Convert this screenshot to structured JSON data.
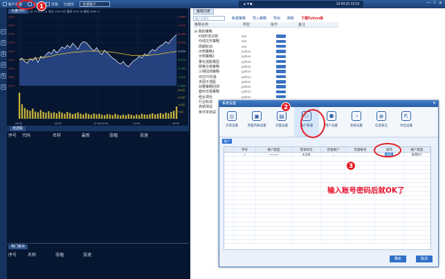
{
  "toolbar": {
    "items": [
      "账户设置",
      "委托",
      "交易",
      "已成交"
    ],
    "dropdown_value": "全部账户",
    "center_left": "▲▼◆",
    "center_time": "13:43:15 13:19",
    "window_controls": [
      "—",
      "□",
      "✕"
    ]
  },
  "rail": {
    "items": [
      "行",
      "资",
      "委",
      "成",
      "策",
      "设"
    ]
  },
  "chart": {
    "tab": "大盘分时",
    "info": "上证 3105.97 ▲ 成交 1230.5亿  最高 3120.48  最低 3085.17",
    "right_ticks": [
      "1.48%",
      "1.11%",
      "0.74%",
      "0.37%",
      "0.00%",
      "0.37%",
      "0.74%",
      "1.11%",
      "1.48%"
    ],
    "left_ticks": [
      "3150",
      "3140",
      "3130",
      "3120",
      "3110",
      "3100",
      "3090",
      "3080",
      "3070"
    ],
    "volume_ticks": [
      "280亿",
      "210亿",
      "140亿",
      "70亿"
    ],
    "time_ticks": [
      "09:30",
      "10:30",
      "11:30/13:00",
      "14:00",
      "15:00"
    ],
    "price_series": [
      3100,
      3102,
      3098,
      3096,
      3101,
      3099,
      3103,
      3097,
      3104,
      3102,
      3106,
      3109,
      3107,
      3112,
      3108,
      3111,
      3115,
      3113,
      3117,
      3114,
      3119,
      3116,
      3112,
      3118,
      3121,
      3120,
      3117,
      3113,
      3110,
      3114,
      3109,
      3106,
      3111,
      3108,
      3105,
      3102,
      3100,
      3097,
      3095,
      3098,
      3094,
      3092,
      3096,
      3099,
      3101,
      3104,
      3102,
      3107,
      3105,
      3109,
      3112,
      3110,
      3114,
      3116,
      3118,
      3121,
      3119,
      3123,
      3126,
      3129
    ],
    "avg_series": [
      3100,
      3100,
      3100,
      3100,
      3101,
      3101,
      3101,
      3102,
      3102,
      3103,
      3103,
      3104,
      3104,
      3105,
      3106,
      3106,
      3107,
      3107,
      3108,
      3108,
      3109,
      3109,
      3109,
      3109,
      3110,
      3110,
      3110,
      3110,
      3110,
      3110,
      3110,
      3110,
      3110,
      3109,
      3109,
      3109,
      3108,
      3108,
      3107,
      3107,
      3106,
      3106,
      3105,
      3105,
      3105,
      3105,
      3105,
      3105,
      3105,
      3105,
      3106,
      3106,
      3106,
      3107,
      3107,
      3108,
      3108,
      3109,
      3109,
      3110
    ],
    "volume_series": [
      72,
      40,
      30,
      25,
      22,
      28,
      20,
      18,
      24,
      19,
      17,
      21,
      16,
      18,
      15,
      20,
      17,
      14,
      19,
      16,
      13,
      15,
      18,
      14,
      12,
      16,
      13,
      11,
      15,
      12,
      14,
      11,
      10,
      13,
      12,
      10,
      14,
      11,
      9,
      12,
      10,
      13,
      11,
      9,
      12,
      10,
      14,
      12,
      11,
      13,
      15,
      12,
      14,
      16,
      13,
      17,
      15,
      19,
      22,
      34
    ]
  },
  "mid_bar": {
    "tab": "自选股"
  },
  "list1": {
    "headers": [
      "序号",
      "代码",
      "名称",
      "最新",
      "涨幅",
      "涨速"
    ]
  },
  "list2": {
    "tab": "热门板块",
    "headers": [
      "序号",
      "名称",
      "涨幅",
      "涨速"
    ]
  },
  "right": {
    "tab": "策略列表",
    "search_placeholder": "输入关键字",
    "toolbar_links": [
      "新建策略",
      "导入策略",
      "导出",
      "刷新"
    ],
    "toolbar_red": "下载Python库",
    "headers": [
      "策略名称",
      "类型",
      "操作",
      "备注"
    ],
    "tree_root": "⊟ 我的策略",
    "rows": [
      {
        "name": "K线形态识别",
        "type": "vba"
      },
      {
        "name": "均线交叉策略",
        "type": "vba"
      },
      {
        "name": "周期轮动",
        "type": "vba"
      },
      {
        "name": "示例策略1",
        "type": "python"
      },
      {
        "name": "示例策略2",
        "type": "python"
      },
      {
        "name": "量化选股模型",
        "type": "python"
      },
      {
        "name": "网格交易策略",
        "type": "python"
      },
      {
        "name": "三档回测策略",
        "type": "python"
      },
      {
        "name": "日内T0交易",
        "type": "python"
      },
      {
        "name": "多因子选股",
        "type": "python"
      },
      {
        "name": "动量策略回测",
        "type": "python"
      },
      {
        "name": "套利交易策略",
        "type": "python"
      },
      {
        "name": "组合调仓",
        "type": "python"
      },
      {
        "name": "行业轮动",
        "type": "python"
      },
      {
        "name": "高频测试",
        "type": "python"
      },
      {
        "name": "条件单测试",
        "type": "python"
      }
    ]
  },
  "modal": {
    "title": "系统设置",
    "close": "✕",
    "icons": [
      {
        "label": "交易设置",
        "glyph": "◎"
      },
      {
        "label": "界面风格设置",
        "glyph": "▣"
      },
      {
        "label": "页面设置",
        "glyph": "▤"
      },
      {
        "label": "账户管理",
        "glyph": "⚇"
      },
      {
        "label": "用户设置",
        "glyph": "⚉"
      },
      {
        "label": "系统设置",
        "glyph": "◔"
      },
      {
        "label": "信息安全",
        "glyph": "⊕"
      },
      {
        "label": "导出设置",
        "glyph": "⇱"
      }
    ],
    "subtab": "账户",
    "grid_headers": [
      "序号",
      "账户类型",
      "登录状态",
      "资金账户",
      "资金账号",
      "操作",
      "账户类型"
    ],
    "grid_row": [
      "1",
      "××××××",
      "未连接",
      "—",
      "",
      "连接",
      "普通账户"
    ],
    "buttons": [
      "确定",
      "取消"
    ]
  },
  "annotation": "输入账号密码后就OK了",
  "callouts": [
    "1",
    "2",
    "3"
  ],
  "colors": {
    "callout": "#e21b22",
    "price_line": "#e8edf7",
    "area": "#2c4a8c",
    "avg_line": "#e7c93a",
    "volume": "#c7b33a"
  }
}
